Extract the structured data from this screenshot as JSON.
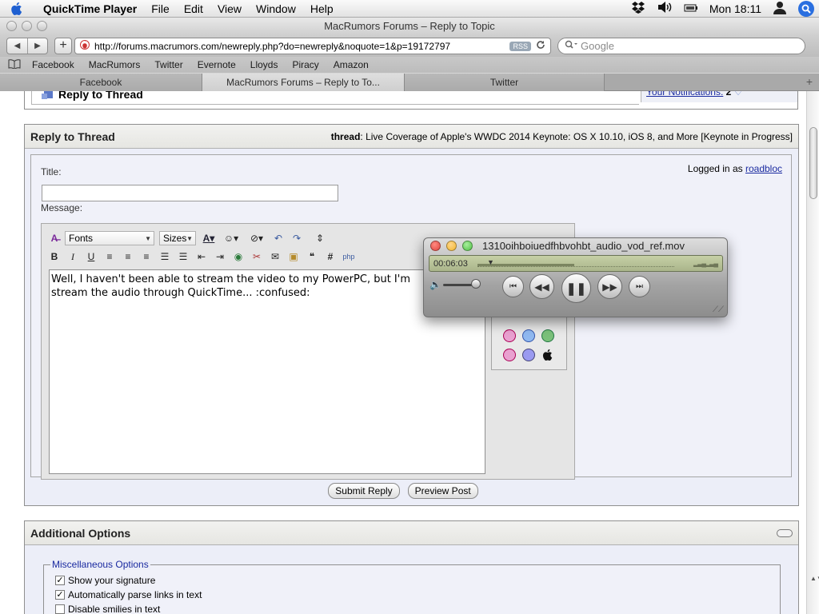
{
  "menubar": {
    "app_name": "QuickTime Player",
    "items": [
      "File",
      "Edit",
      "View",
      "Window",
      "Help"
    ],
    "clock": "Mon 18:11"
  },
  "window": {
    "title": "MacRumors Forums – Reply to Topic"
  },
  "toolbar": {
    "url": "http://forums.macrumors.com/newreply.php?do=newreply&noquote=1&p=19172797",
    "rss_label": "RSS",
    "search_placeholder": "Google"
  },
  "bookmarks": [
    "Facebook",
    "MacRumors",
    "Twitter",
    "Evernote",
    "Lloyds",
    "Piracy",
    "Amazon"
  ],
  "tabs": [
    {
      "label": "Facebook",
      "active": false
    },
    {
      "label": "MacRumors Forums – Reply to To...",
      "active": true
    },
    {
      "label": "Twitter",
      "active": false
    }
  ],
  "topbox": {
    "title": "Reply to Thread",
    "notifications_label": "Your Notifications:",
    "notifications_count": "2"
  },
  "reply_panel": {
    "heading": "Reply to Thread",
    "thread_label": "thread",
    "thread_title": "Live Coverage of Apple's WWDC 2014 Keynote: OS X 10.10, iOS 8, and More [Keynote in Progress]",
    "title_label": "Title:",
    "title_value": "",
    "logged_in_prefix": "Logged in as",
    "username": "roadbloc",
    "message_label": "Message:",
    "fonts_label": "Fonts",
    "sizes_label": "Sizes",
    "message_text": "Well, I haven't been able to stream the video to my PowerPC, but I'm\nstream the audio through QuickTime... :confused:"
  },
  "buttons": {
    "submit": "Submit Reply",
    "preview": "Preview Post"
  },
  "additional_options": {
    "heading": "Additional Options",
    "misc_legend": "Miscellaneous Options",
    "options": [
      {
        "label": "Show your signature",
        "checked": true
      },
      {
        "label": "Automatically parse links in text",
        "checked": true
      },
      {
        "label": "Disable smilies in text",
        "checked": false
      }
    ]
  },
  "quicktime": {
    "filename": "1310oihboiuedfhbvohbt_audio_vod_ref.mov",
    "elapsed": "00:06:03",
    "progress_fraction": 0.048,
    "loaded_fraction": 0.49,
    "volume_fraction": 0.9
  },
  "colors": {
    "link": "#1a2aa0",
    "panel_bg": "#eceef8",
    "lcd": "#b8c398",
    "close_red": "#e0443e",
    "minimize_yellow": "#f1b72f",
    "zoom_green": "#4fbf44"
  },
  "icons": [
    "apple-icon",
    "dropbox-icon",
    "volume-icon",
    "battery-icon",
    "user-icon",
    "spotlight-icon",
    "bookmarks-book-icon",
    "reload-icon"
  ]
}
